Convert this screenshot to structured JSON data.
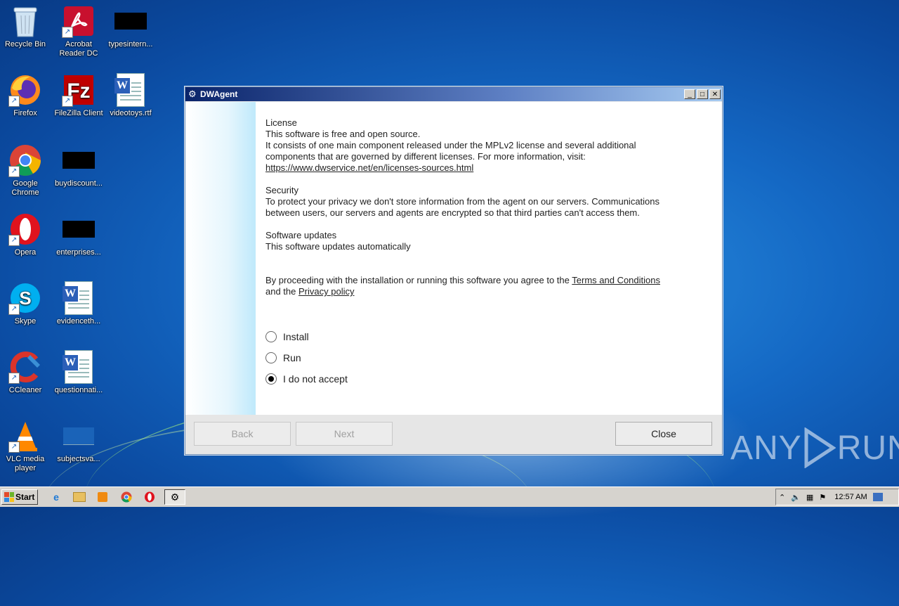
{
  "desktop": {
    "icons": [
      {
        "label": "Recycle Bin"
      },
      {
        "label": "Acrobat Reader DC"
      },
      {
        "label": "typesintern..."
      },
      {
        "label": "Firefox"
      },
      {
        "label": "FileZilla Client"
      },
      {
        "label": "videotoys.rtf"
      },
      {
        "label": "Google Chrome"
      },
      {
        "label": "buydiscount..."
      },
      {
        "label": "Opera"
      },
      {
        "label": "enterprises..."
      },
      {
        "label": "Skype"
      },
      {
        "label": "evidenceth..."
      },
      {
        "label": "CCleaner"
      },
      {
        "label": "questionnati..."
      },
      {
        "label": "VLC media player"
      },
      {
        "label": "subjectsva..."
      }
    ]
  },
  "window": {
    "title": "DWAgent",
    "controls": {
      "minimize": "_",
      "maximize": "□",
      "close": "✕"
    },
    "license_heading": "License",
    "license_line1": "This software is free and open source.",
    "license_line2": "It consists of one main component released under the MPLv2 license and several additional",
    "license_line3": "components that are governed by different licenses. For more information, visit:",
    "license_link": "https://www.dwservice.net/en/licenses-sources.html",
    "security_heading": "Security",
    "security_line1": "To protect your privacy we don't store information from the agent on our servers. Communications",
    "security_line2": "between users, our servers and agents are encrypted so that third parties can't access them.",
    "updates_heading": "Software updates",
    "updates_line1": "This software updates automatically",
    "agree_prefix": "By proceeding with the installation or running this software you agree to the",
    "terms_link": "Terms and Conditions",
    "agree_and": "and the",
    "privacy_link": "Privacy policy",
    "options": [
      {
        "label": "Install",
        "selected": false
      },
      {
        "label": "Run",
        "selected": false
      },
      {
        "label": "I do not accept",
        "selected": true
      }
    ],
    "buttons": {
      "back": "Back",
      "next": "Next",
      "close": "Close"
    }
  },
  "watermark": {
    "left": "ANY",
    "right": "RUN"
  },
  "taskbar": {
    "start_label": "Start",
    "clock": "12:57 AM"
  },
  "colors": {
    "accent_title": "#0a246a",
    "desktop_blue": "#1468c4"
  }
}
